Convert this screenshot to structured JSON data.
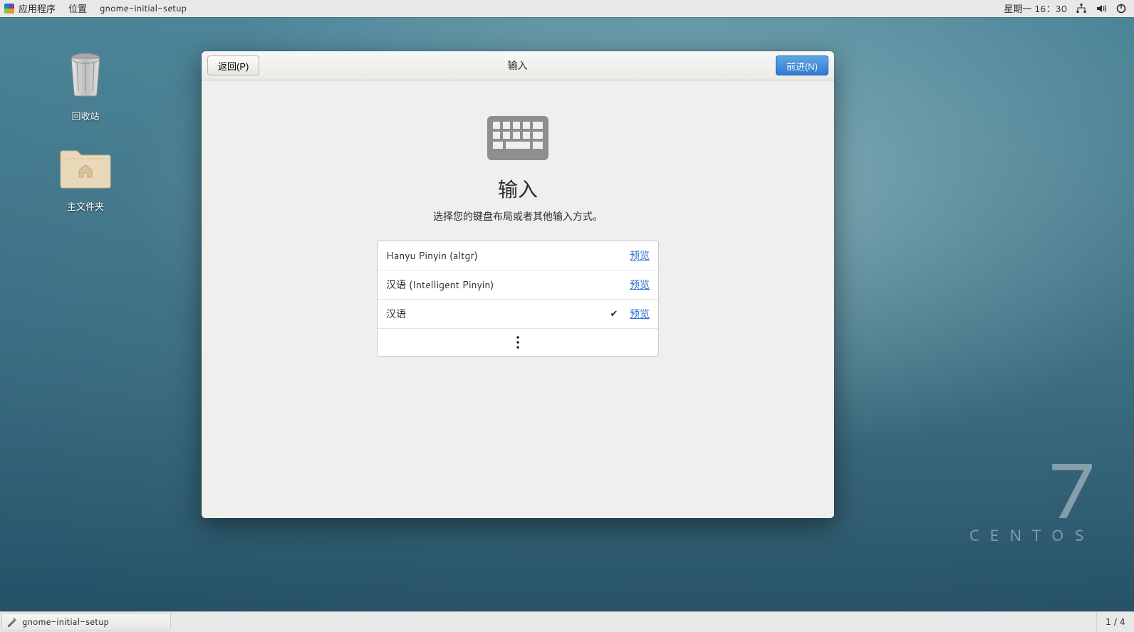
{
  "top_panel": {
    "menu_applications": "应用程序",
    "menu_places": "位置",
    "active_app": "gnome-initial-setup",
    "clock": "星期一 16：30"
  },
  "desktop_icons": {
    "trash": "回收站",
    "home": "主文件夹"
  },
  "branding": {
    "version": "7",
    "distro": "CENTOS"
  },
  "setup": {
    "back_label": "返回(P)",
    "title": "输入",
    "next_label": "前进(N)",
    "heading": "输入",
    "subtitle": "选择您的键盘布局或者其他输入方式。",
    "preview_label": "预览",
    "layouts": [
      {
        "name": "Hanyu Pinyin (altgr)",
        "selected": false
      },
      {
        "name": "汉语  (Intelligent Pinyin)",
        "selected": false
      },
      {
        "name": "汉语",
        "selected": true
      }
    ]
  },
  "bottom_panel": {
    "task": "gnome-initial-setup",
    "workspace": "1 / 4"
  }
}
